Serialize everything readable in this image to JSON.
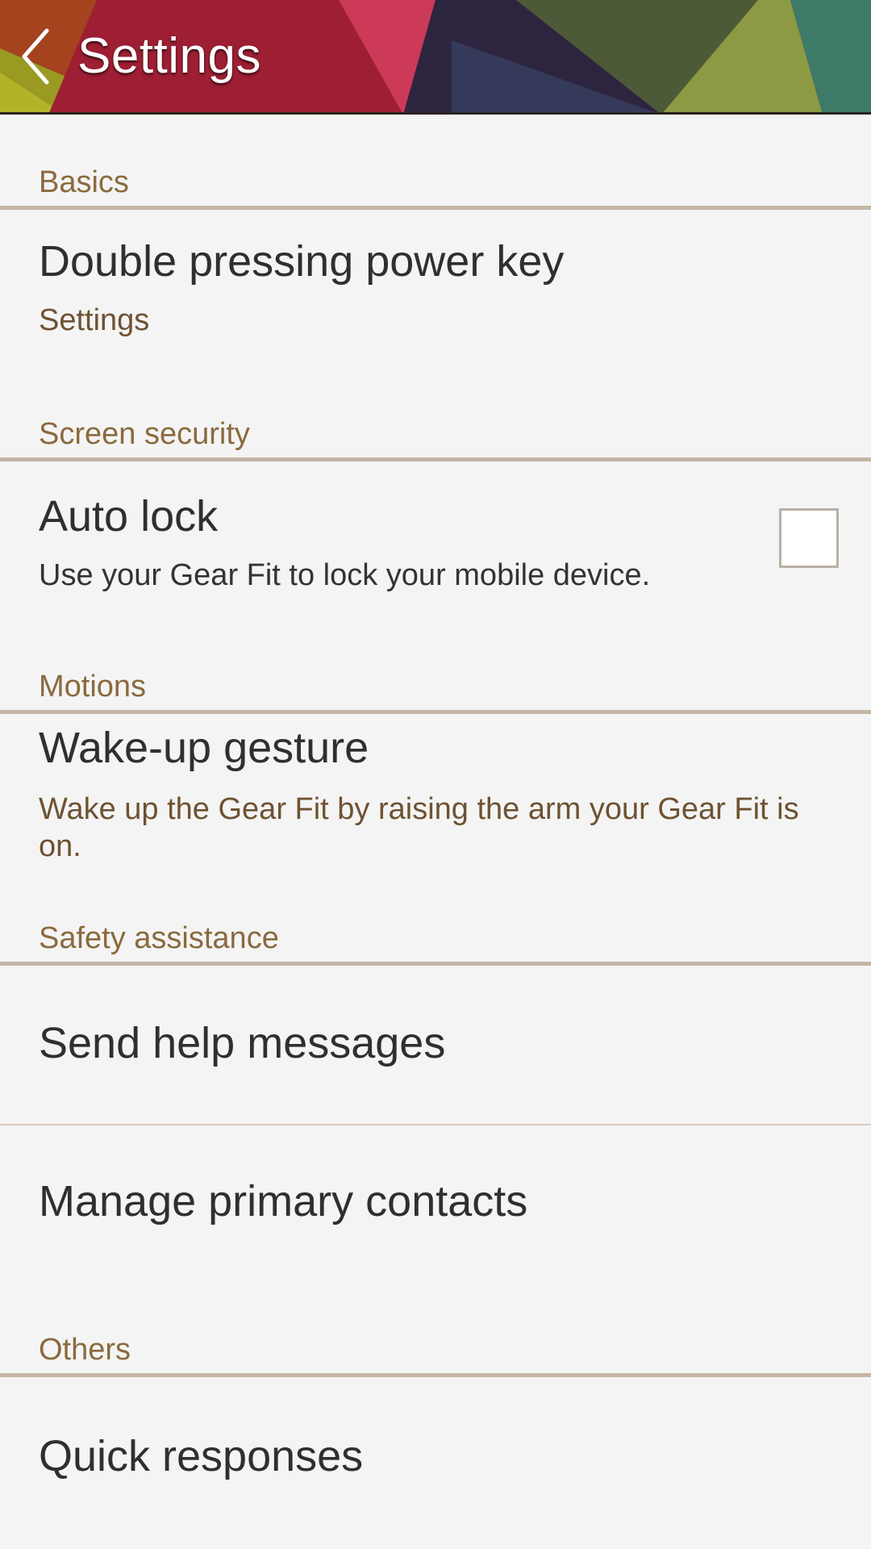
{
  "header": {
    "title": "Settings",
    "back_icon": "chevron-left-icon"
  },
  "sections": {
    "basics": {
      "label": "Basics",
      "double_press": {
        "title": "Double pressing power key",
        "subtitle": "Settings"
      }
    },
    "screen_security": {
      "label": "Screen security",
      "auto_lock": {
        "title": "Auto lock",
        "subtitle": "Use your Gear Fit to lock your mobile device.",
        "checked": false
      }
    },
    "motions": {
      "label": "Motions",
      "wake_up": {
        "title": "Wake-up gesture",
        "subtitle": "Wake up the Gear Fit by raising the arm your Gear Fit is on."
      }
    },
    "safety": {
      "label": "Safety assistance",
      "send_help": {
        "title": "Send help messages"
      },
      "manage_contacts": {
        "title": "Manage primary contacts"
      }
    },
    "others": {
      "label": "Others",
      "quick_responses": {
        "title": "Quick responses"
      }
    }
  },
  "colors": {
    "section_label": "#8a6a3e",
    "subtitle_brown": "#6e5232",
    "divider": "#c4b5a6",
    "background": "#f4f4f4"
  }
}
